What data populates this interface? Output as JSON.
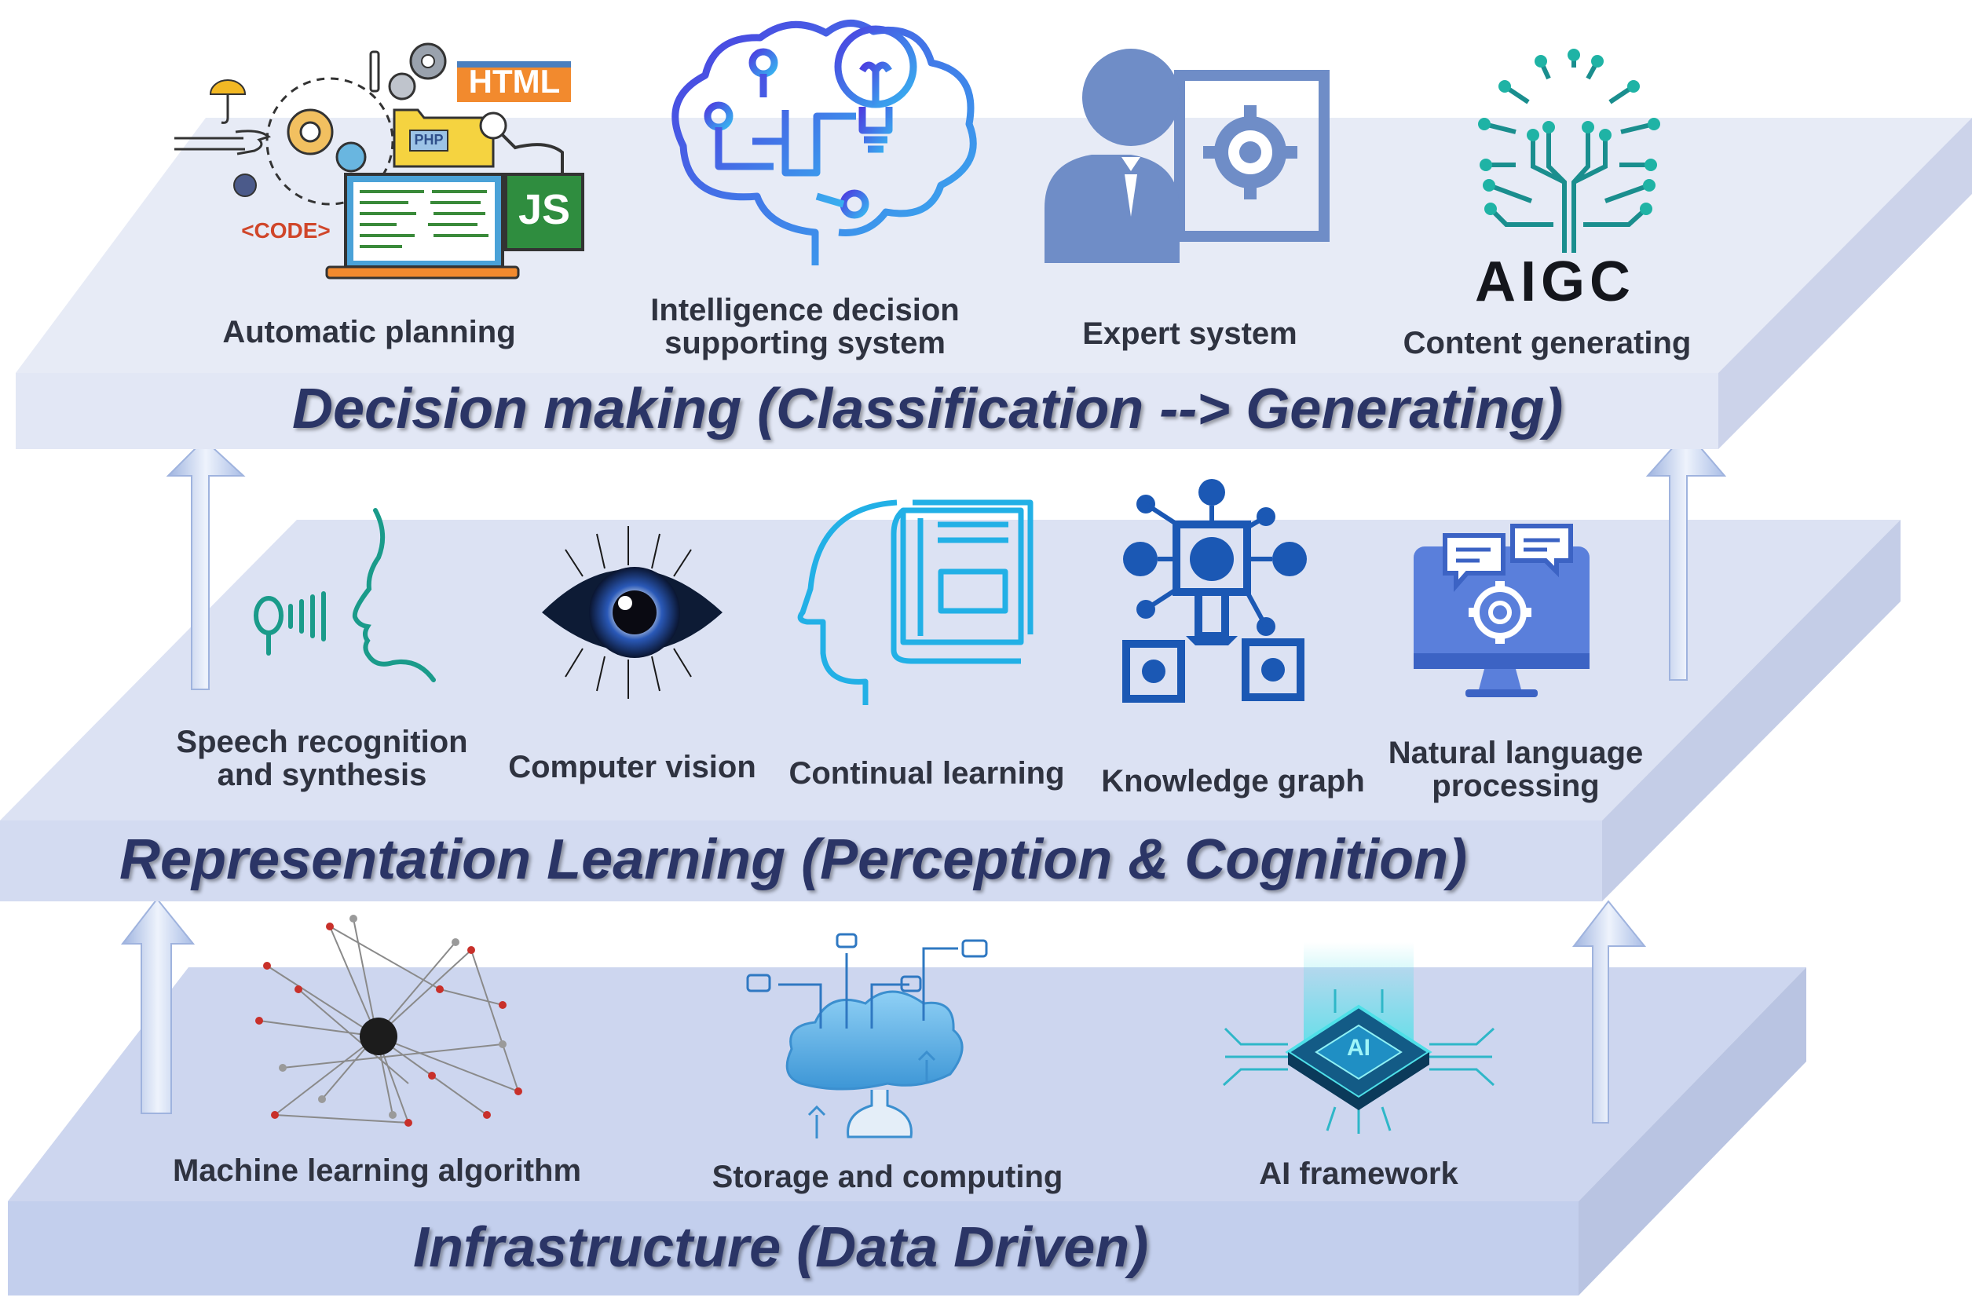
{
  "layers": {
    "decision": {
      "title": "Decision making (Classification --> Generating)",
      "items": {
        "automatic_planning": "Automatic planning",
        "intelligence_decision_line1": "Intelligence decision",
        "intelligence_decision_line2": "supporting system",
        "expert_system": "Expert system",
        "content_generating": "Content generating"
      },
      "icon_text": {
        "html": "HTML",
        "code": "<CODE>",
        "php": "PHP",
        "js": "JS",
        "aigc": "AIGC"
      }
    },
    "representation": {
      "title": "Representation Learning (Perception & Cognition)",
      "items": {
        "speech_line1": "Speech recognition",
        "speech_line2": "and synthesis",
        "computer_vision": "Computer vision",
        "continual_learning": "Continual learning",
        "knowledge_graph": "Knowledge graph",
        "nlp_line1": "Natural language",
        "nlp_line2": "processing"
      }
    },
    "infrastructure": {
      "title": "Infrastructure (Data Driven)",
      "items": {
        "ml_algorithm": "Machine learning algorithm",
        "storage_computing": "Storage and computing",
        "ai_framework": "AI framework"
      },
      "icon_text": {
        "ai_chip": "AI"
      }
    }
  },
  "colors": {
    "layer_top": "#e8ecf7",
    "layer_mid": "#d9e0f1",
    "layer_bottom": "#cdd7ee",
    "title_text": "#2b3566",
    "arrow": "#c6d3ef",
    "icon_blue": "#3f6fcf",
    "icon_teal": "#1a9b8a"
  }
}
